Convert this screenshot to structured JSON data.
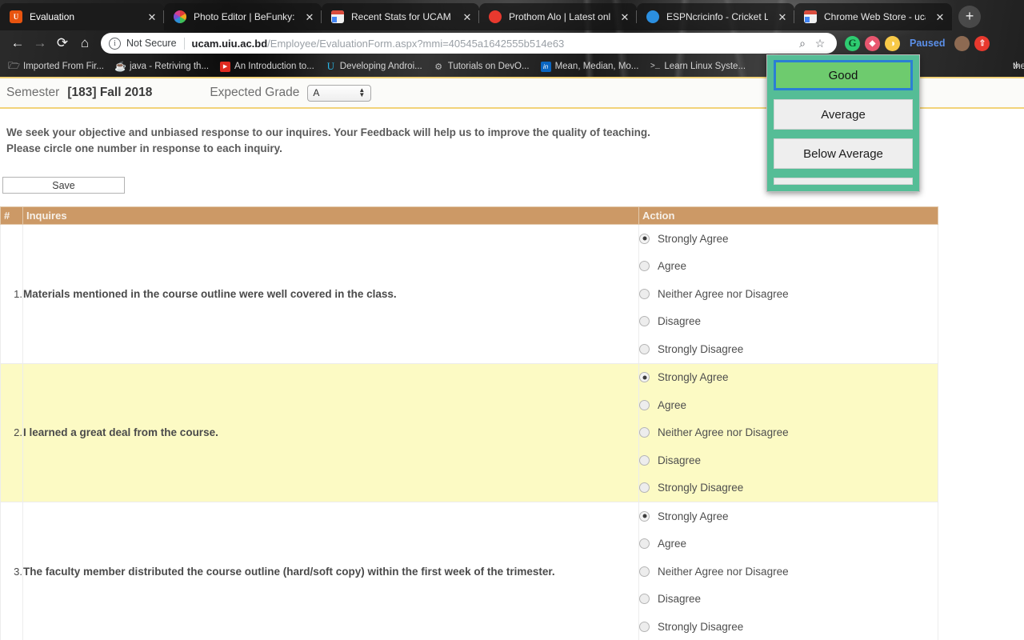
{
  "browser": {
    "tabs": [
      {
        "title": "Evaluation",
        "favicon": "uiu-logo-icon",
        "active": true
      },
      {
        "title": "Photo Editor | BeFunky: Free",
        "favicon": "befunky-icon",
        "active": false
      },
      {
        "title": "Recent Stats for UCAM Cou",
        "favicon": "chrome-web-store-icon",
        "active": false
      },
      {
        "title": "Prothom Alo | Latest online",
        "favicon": "prothom-alo-icon",
        "active": false
      },
      {
        "title": "ESPNcricinfo - Cricket Live",
        "favicon": "espncricinfo-icon",
        "active": false
      },
      {
        "title": "Chrome Web Store - ucam",
        "favicon": "chrome-web-store-icon",
        "active": false
      }
    ],
    "new_tab_label": "+",
    "close_label": "✕",
    "nav": {
      "back": "←",
      "forward": "→",
      "reload": "⟳",
      "home": "⌂"
    },
    "omnibox": {
      "info_glyph": "i",
      "security_label": "Not Secure",
      "url_bold": "ucam.uiu.ac.bd",
      "url_rest": "/Employee/EvaluationForm.aspx?mmi=40545a1642555b514e63",
      "zoom_glyph": "⌕",
      "bookmark_glyph": "☆"
    },
    "extensions": [
      {
        "name": "grammarly-extension-icon",
        "glyph": "G"
      },
      {
        "name": "adblock-shield-extension-icon",
        "glyph": "◆"
      },
      {
        "name": "emoji-extension-icon",
        "glyph": "◑"
      }
    ],
    "paused_label": "Paused",
    "profile_avatar_name": "profile-avatar",
    "update_icon_name": "update-arrow-icon",
    "bookmarks": [
      {
        "label": "Imported From Fir...",
        "icon": "folder-icon"
      },
      {
        "label": "java - Retriving th...",
        "icon": "java-icon"
      },
      {
        "label": "An Introduction to...",
        "icon": "youtube-icon"
      },
      {
        "label": "Developing Androi...",
        "icon": "udacity-icon"
      },
      {
        "label": "Tutorials on DevO...",
        "icon": "gear-icon"
      },
      {
        "label": "Mean, Median, Mo...",
        "icon": "linkedin-icon"
      },
      {
        "label": "Learn Linux Syste...",
        "icon": "terminal-icon"
      },
      {
        "label": "the simple gu...",
        "icon": "generic-bookmark-icon"
      }
    ],
    "bookmarks_overflow_glyph": "»"
  },
  "form": {
    "semester_label": "Semester",
    "semester_value": "[183] Fall 2018",
    "grade_label": "Expected Grade",
    "grade_value": "A",
    "intro_line1": "We seek your objective and unbiased response to our inquires. Your Feedback will help us to improve the quality of teaching.",
    "intro_line2": "Please circle one number in response to each inquiry.",
    "save_label": "Save",
    "table": {
      "headers": {
        "num": "#",
        "inquiry": "Inquires",
        "action": "Action"
      },
      "options": [
        "Strongly Agree",
        "Agree",
        "Neither Agree nor Disagree",
        "Disagree",
        "Strongly Disagree"
      ],
      "rows": [
        {
          "num": "1.",
          "text": "Materials mentioned in the course outline were well covered in the class.",
          "selected": "Strongly Agree",
          "highlight": false
        },
        {
          "num": "2.",
          "text": "I learned a great deal from the course.",
          "selected": "Strongly Agree",
          "highlight": true
        },
        {
          "num": "3.",
          "text": "The faculty member distributed the course outline (hard/soft copy) within the first week of the trimester.",
          "selected": "Strongly Agree",
          "highlight": false
        }
      ]
    }
  },
  "dropdown": {
    "name": "evaluation-rating-dropdown",
    "items": [
      {
        "label": "Good",
        "selected": true
      },
      {
        "label": "Average",
        "selected": false
      },
      {
        "label": "Below Average",
        "selected": false
      }
    ],
    "has_partial_item": true
  },
  "colors": {
    "table_header": "#cc9966",
    "row_highlight": "#fcfac4",
    "semester_border": "#f2d37a",
    "dropdown_bg": "#55bd96",
    "dropdown_selected": "#6ecb6e",
    "dropdown_focus_ring": "#2b7fd4",
    "paused_text": "#5b8fe8"
  }
}
